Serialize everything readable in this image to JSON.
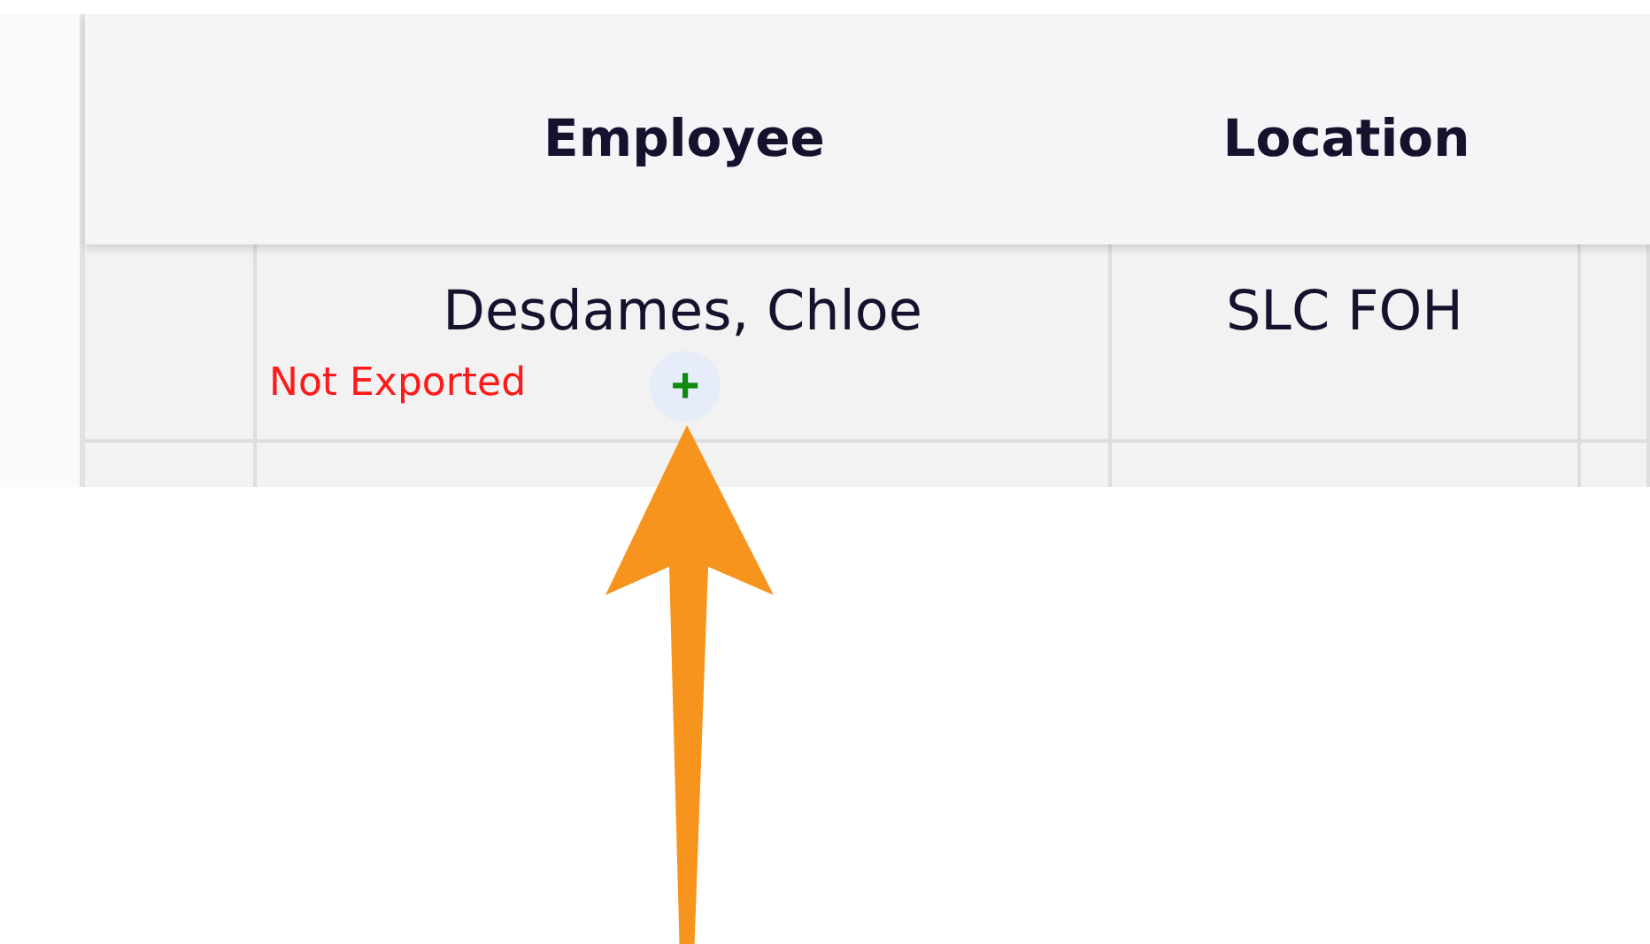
{
  "table": {
    "columns": [
      "Employee",
      "Location"
    ],
    "rows": [
      {
        "employee": "Desdames, Chloe",
        "location": "SLC FOH",
        "export_status": "Not Exported",
        "add_button": "+"
      }
    ]
  },
  "annotation": {
    "kind": "arrow"
  }
}
